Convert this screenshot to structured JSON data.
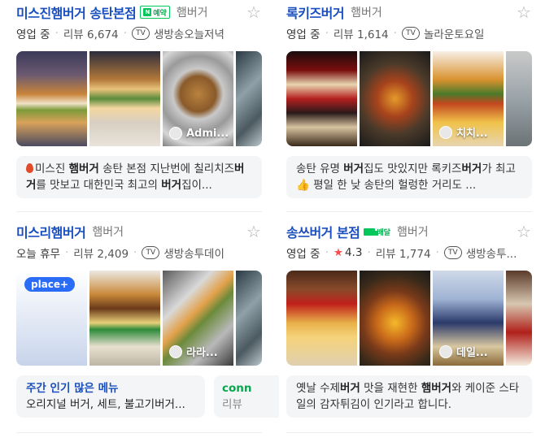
{
  "listings": [
    {
      "name": "미스진햄버거 송탄본점",
      "badge": "예약",
      "badge_icon": "N",
      "category": "햄버거",
      "status": "영업 중",
      "reviews": "리뷰 6,674",
      "tv_label": "TV",
      "tv_text": "생방송오늘저녁",
      "photos": [
        {
          "caption": ""
        },
        {
          "caption": ""
        },
        {
          "caption": "Admi..."
        },
        {
          "caption": ""
        }
      ],
      "description": [
        {
          "t": "미스진 ",
          "b": false
        },
        {
          "t": "햄버거",
          "b": true
        },
        {
          "t": " 송탄 본점 지난번에 칠리치즈",
          "b": false
        },
        {
          "t": "버거",
          "b": true
        },
        {
          "t": "를 맛보고 대한민국 최고의 ",
          "b": false
        },
        {
          "t": "버거",
          "b": true
        },
        {
          "t": "집이...",
          "b": false
        }
      ]
    },
    {
      "name": "록키즈버거",
      "category": "햄버거",
      "status": "영업 중",
      "reviews": "리뷰 1,614",
      "tv_label": "TV",
      "tv_text": "놀라운토요일",
      "photos": [
        {
          "caption": ""
        },
        {
          "caption": ""
        },
        {
          "caption": "치치..."
        },
        {
          "caption": ""
        }
      ],
      "description": [
        {
          "t": "송탄 유명 ",
          "b": false
        },
        {
          "t": "버거",
          "b": true
        },
        {
          "t": "집도 맛있지만 록키즈",
          "b": false
        },
        {
          "t": "버거",
          "b": true
        },
        {
          "t": "가 최고",
          "b": false
        },
        {
          "t": "👍",
          "b": false
        },
        {
          "t": " 평일 한 낮 송탄의 헐렁한 거리도 ...",
          "b": false
        }
      ]
    },
    {
      "name": "미스리햄버거",
      "category": "햄버거",
      "status": "오늘 휴무",
      "reviews": "리뷰 2,409",
      "tv_label": "TV",
      "tv_text": "생방송투데이",
      "place_badge": "place+",
      "photos": [
        {
          "caption": ""
        },
        {
          "caption": ""
        },
        {
          "caption": "라라..."
        },
        {
          "caption": ""
        }
      ],
      "theme_title": "주간 인기 많은 메뉴",
      "theme_text": "오리지널 버거, 세트, 불고기버거...",
      "theme2_title": "conn",
      "theme2_text": "리뷰"
    },
    {
      "name": "송쓰버거 본점",
      "badge": "배달",
      "category": "햄버거",
      "status": "영업 중",
      "rating": "4.3",
      "reviews": "리뷰 1,774",
      "tv_label": "TV",
      "tv_text": "생방송투...",
      "photos": [
        {
          "caption": ""
        },
        {
          "caption": ""
        },
        {
          "caption": "데일..."
        },
        {
          "caption": ""
        }
      ],
      "description": [
        {
          "t": "옛날 수제",
          "b": false
        },
        {
          "t": "버거",
          "b": true
        },
        {
          "t": " 맛을 재현한 ",
          "b": false
        },
        {
          "t": "햄버거",
          "b": true
        },
        {
          "t": "와 케이준 스타일의 감자튀김이 인기라고 합니다.",
          "b": false
        }
      ]
    }
  ]
}
